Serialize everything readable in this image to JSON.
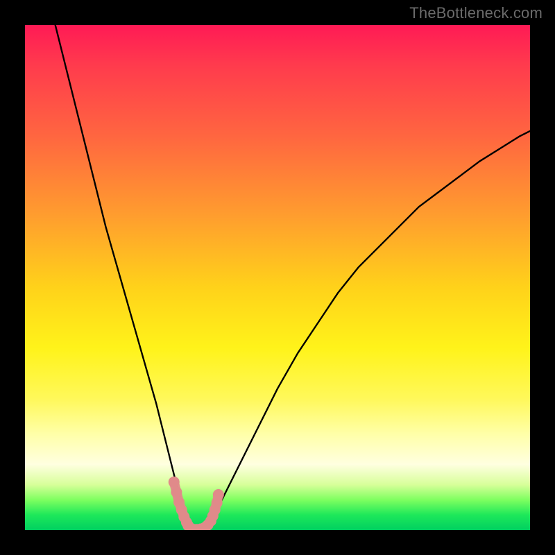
{
  "watermark": "TheBottleneck.com",
  "chart_data": {
    "type": "line",
    "title": "",
    "xlabel": "",
    "ylabel": "",
    "xlim": [
      0,
      100
    ],
    "ylim": [
      0,
      100
    ],
    "grid": false,
    "legend": false,
    "series": [
      {
        "name": "curve",
        "color": "#000000",
        "x": [
          6,
          8,
          10,
          12,
          14,
          16,
          18,
          20,
          22,
          24,
          26,
          27,
          28,
          29,
          30,
          31,
          32,
          32.5,
          33,
          34,
          35,
          36,
          37,
          38,
          40,
          42,
          44,
          46,
          48,
          50,
          54,
          58,
          62,
          66,
          70,
          74,
          78,
          82,
          86,
          90,
          94,
          98,
          100
        ],
        "y": [
          100,
          92,
          84,
          76,
          68,
          60,
          53,
          46,
          39,
          32,
          25,
          21,
          17,
          13,
          9,
          5,
          2,
          0.5,
          0,
          0,
          0,
          0.5,
          2,
          4,
          8,
          12,
          16,
          20,
          24,
          28,
          35,
          41,
          47,
          52,
          56,
          60,
          64,
          67,
          70,
          73,
          75.5,
          78,
          79
        ]
      },
      {
        "name": "marker-band",
        "color": "#e08a8a",
        "x": [
          29.5,
          30.0,
          30.5,
          31.0,
          31.5,
          32.0,
          32.3,
          32.6,
          33.0,
          33.5,
          34.0,
          34.8,
          35.6,
          36.2,
          36.8,
          37.2,
          37.6,
          38.0,
          38.3
        ],
        "y": [
          9.5,
          7.5,
          5.5,
          4.0,
          2.6,
          1.5,
          0.9,
          0.5,
          0.2,
          0.1,
          0.1,
          0.2,
          0.5,
          1.0,
          1.8,
          2.8,
          4.0,
          5.4,
          7.0
        ]
      }
    ],
    "background_gradient": {
      "stops": [
        {
          "offset": 0.0,
          "color": "#ff1a55"
        },
        {
          "offset": 0.08,
          "color": "#ff3b4d"
        },
        {
          "offset": 0.22,
          "color": "#ff6640"
        },
        {
          "offset": 0.38,
          "color": "#ff9e2e"
        },
        {
          "offset": 0.52,
          "color": "#ffd21a"
        },
        {
          "offset": 0.64,
          "color": "#fff31a"
        },
        {
          "offset": 0.74,
          "color": "#fff85a"
        },
        {
          "offset": 0.81,
          "color": "#ffffa8"
        },
        {
          "offset": 0.87,
          "color": "#ffffe0"
        },
        {
          "offset": 0.91,
          "color": "#d8ff9a"
        },
        {
          "offset": 0.94,
          "color": "#7fff60"
        },
        {
          "offset": 0.97,
          "color": "#1ee85a"
        },
        {
          "offset": 1.0,
          "color": "#00d060"
        }
      ]
    }
  }
}
